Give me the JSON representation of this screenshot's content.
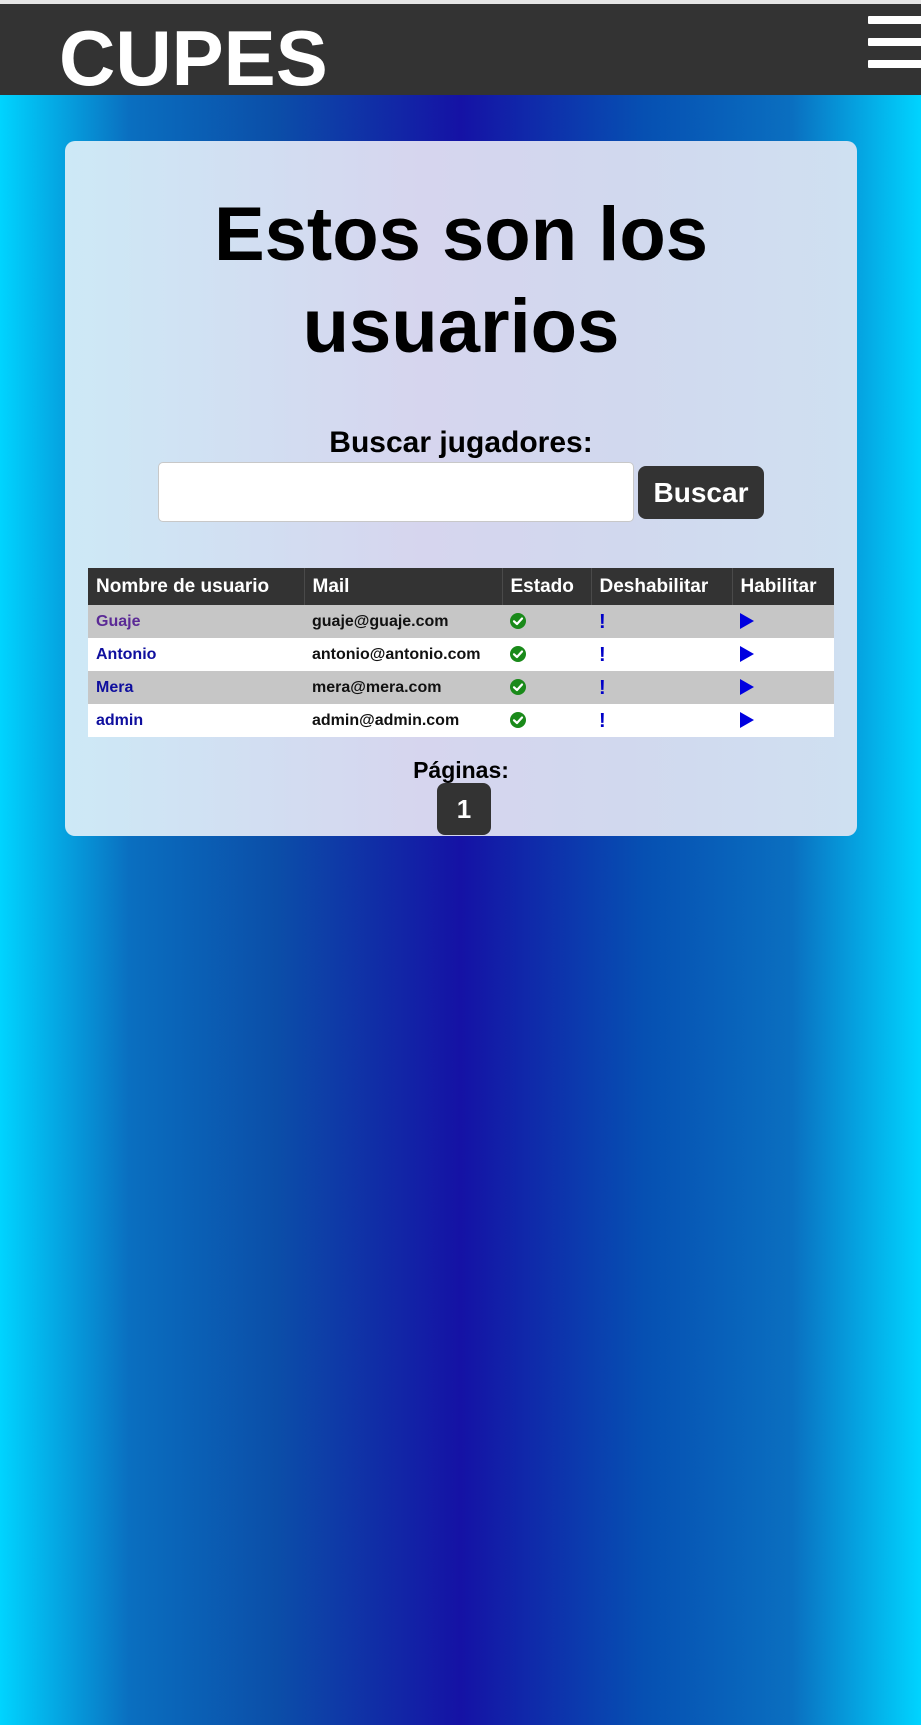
{
  "header": {
    "brand": "CUPES",
    "menu_icon": "hamburger-menu-icon"
  },
  "main": {
    "title": "Estos son los usuarios",
    "search": {
      "label": "Buscar jugadores:",
      "value": "",
      "placeholder": "",
      "button_label": "Buscar"
    },
    "table": {
      "columns": [
        "Nombre de usuario",
        "Mail",
        "Estado",
        "Deshabilitar",
        "Habilitar"
      ],
      "rows": [
        {
          "username": "Guaje",
          "mail": "guaje@guaje.com",
          "status_icon": "check-circle-icon",
          "disable_icon": "exclamation-icon",
          "enable_icon": "play-icon"
        },
        {
          "username": "Antonio",
          "mail": "antonio@antonio.com",
          "status_icon": "check-circle-icon",
          "disable_icon": "exclamation-icon",
          "enable_icon": "play-icon"
        },
        {
          "username": "Mera",
          "mail": "mera@mera.com",
          "status_icon": "check-circle-icon",
          "disable_icon": "exclamation-icon",
          "enable_icon": "play-icon"
        },
        {
          "username": "admin",
          "mail": "admin@admin.com",
          "status_icon": "check-circle-icon",
          "disable_icon": "exclamation-icon",
          "enable_icon": "play-icon"
        }
      ]
    },
    "pagination": {
      "label": "Páginas:",
      "pages": [
        "1"
      ]
    }
  },
  "colors": {
    "header_bg": "#333333",
    "link": "#0f0f9e",
    "visited_link": "#5b2a96",
    "status_ok": "#1a8a1a",
    "action_blue": "#0000e0"
  }
}
